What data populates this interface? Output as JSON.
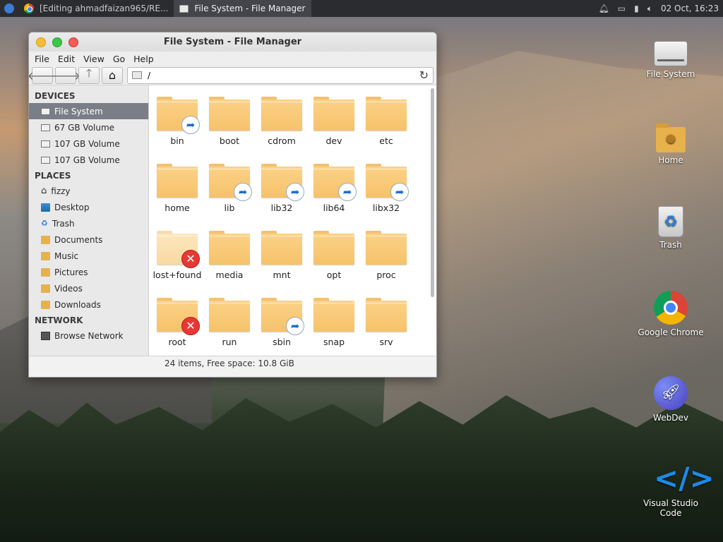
{
  "panel": {
    "tasks": [
      {
        "label": "[Editing ahmadfaizan965/RE..."
      },
      {
        "label": "File System - File Manager"
      }
    ],
    "clock": "02 Oct, 16:23"
  },
  "desktop": {
    "icons": [
      {
        "label": "File System",
        "icon": "drive-icon"
      },
      {
        "label": "Home",
        "icon": "home-folder-icon"
      },
      {
        "label": "Trash",
        "icon": "trash-icon"
      },
      {
        "label": "Google Chrome",
        "icon": "chrome-icon"
      },
      {
        "label": "WebDev",
        "icon": "rocket-icon"
      },
      {
        "label": "Visual Studio Code",
        "icon": "vscode-icon"
      }
    ]
  },
  "window": {
    "title": "File System - File Manager",
    "menu": [
      "File",
      "Edit",
      "View",
      "Go",
      "Help"
    ],
    "location": "/",
    "sidebar": {
      "devices_heading": "DEVICES",
      "devices": [
        "File System",
        "67 GB Volume",
        "107 GB Volume",
        "107 GB Volume"
      ],
      "places_heading": "PLACES",
      "places": [
        "fizzy",
        "Desktop",
        "Trash",
        "Documents",
        "Music",
        "Pictures",
        "Videos",
        "Downloads"
      ],
      "network_heading": "NETWORK",
      "network": [
        "Browse Network"
      ]
    },
    "files": [
      {
        "name": "bin",
        "badge": "link"
      },
      {
        "name": "boot",
        "badge": ""
      },
      {
        "name": "cdrom",
        "badge": ""
      },
      {
        "name": "dev",
        "badge": ""
      },
      {
        "name": "etc",
        "badge": ""
      },
      {
        "name": "home",
        "badge": ""
      },
      {
        "name": "lib",
        "badge": "link"
      },
      {
        "name": "lib32",
        "badge": "link"
      },
      {
        "name": "lib64",
        "badge": "link"
      },
      {
        "name": "libx32",
        "badge": "link"
      },
      {
        "name": "lost+found",
        "badge": "noaccess"
      },
      {
        "name": "media",
        "badge": ""
      },
      {
        "name": "mnt",
        "badge": ""
      },
      {
        "name": "opt",
        "badge": ""
      },
      {
        "name": "proc",
        "badge": ""
      },
      {
        "name": "root",
        "badge": "noaccess"
      },
      {
        "name": "run",
        "badge": ""
      },
      {
        "name": "sbin",
        "badge": "link"
      },
      {
        "name": "snap",
        "badge": ""
      },
      {
        "name": "srv",
        "badge": ""
      }
    ],
    "status": "24 items, Free space: 10.8 GiB"
  }
}
